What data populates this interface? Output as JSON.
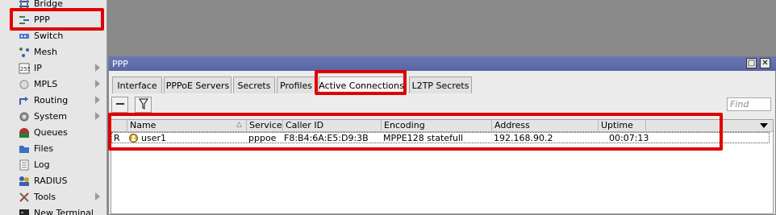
{
  "sidebar": {
    "items": [
      {
        "label": "Bridge",
        "icon": "bridge-icon",
        "submenu": false
      },
      {
        "label": "PPP",
        "icon": "ppp-icon",
        "submenu": false
      },
      {
        "label": "Switch",
        "icon": "switch-icon",
        "submenu": false
      },
      {
        "label": "Mesh",
        "icon": "mesh-icon",
        "submenu": false
      },
      {
        "label": "IP",
        "icon": "ip-icon",
        "submenu": true
      },
      {
        "label": "MPLS",
        "icon": "mpls-icon",
        "submenu": true
      },
      {
        "label": "Routing",
        "icon": "routing-icon",
        "submenu": true
      },
      {
        "label": "System",
        "icon": "system-icon",
        "submenu": true
      },
      {
        "label": "Queues",
        "icon": "queues-icon",
        "submenu": false
      },
      {
        "label": "Files",
        "icon": "files-icon",
        "submenu": false
      },
      {
        "label": "Log",
        "icon": "log-icon",
        "submenu": false
      },
      {
        "label": "RADIUS",
        "icon": "radius-icon",
        "submenu": false
      },
      {
        "label": "Tools",
        "icon": "tools-icon",
        "submenu": true
      },
      {
        "label": "New Terminal",
        "icon": "terminal-icon",
        "submenu": false
      }
    ]
  },
  "window": {
    "title": "PPP",
    "restore_glyph": "□",
    "close_glyph": "✕",
    "tabs": [
      "Interface",
      "PPPoE Servers",
      "Secrets",
      "Profiles",
      "Active Connections",
      "L2TP Secrets"
    ],
    "active_tab": "Active Connections",
    "find_placeholder": "Find"
  },
  "table": {
    "columns": [
      "Name",
      "Service",
      "Caller ID",
      "Encoding",
      "Address",
      "Uptime"
    ],
    "sort_marker": "△",
    "rows": [
      {
        "flag": "R",
        "name": "user1",
        "service": "pppoe",
        "caller_id": "F8:B4:6A:E5:D9:3B",
        "encoding": "MPPE128 statefull",
        "address": "192.168.90.2",
        "uptime": "00:07:13"
      }
    ]
  },
  "colors": {
    "highlight": "#e00000",
    "titlebar": "#5f6dab"
  }
}
